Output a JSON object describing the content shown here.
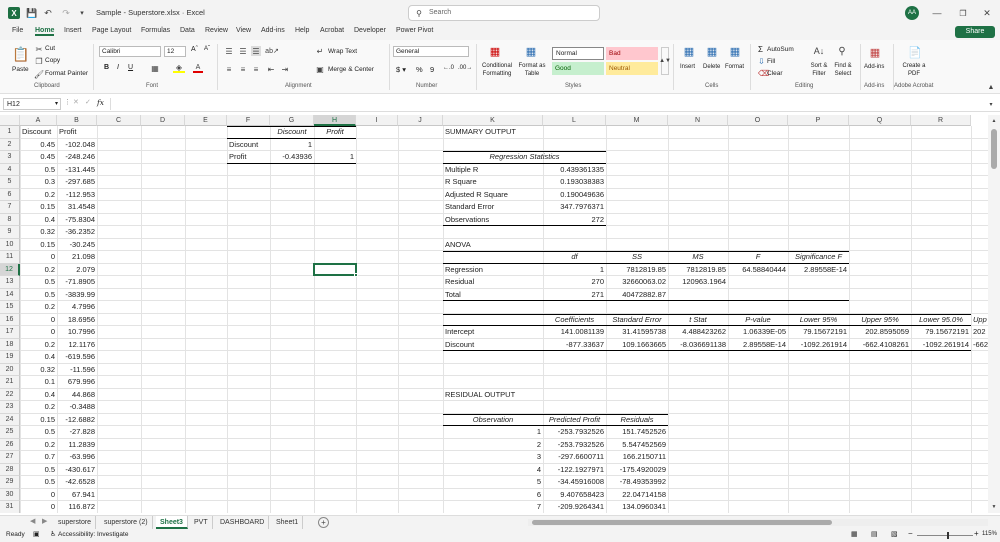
{
  "window": {
    "title": "Sample - Superstore.xlsx  ·  Excel",
    "search_placeholder": "Search",
    "avatar": "AA",
    "share": "Share"
  },
  "menu": [
    "File",
    "Home",
    "Insert",
    "Page Layout",
    "Formulas",
    "Data",
    "Review",
    "View",
    "Add-ins",
    "Help",
    "Acrobat",
    "Developer",
    "Power Pivot"
  ],
  "ribbon": {
    "paste": "Paste",
    "cut": "Cut",
    "copy": "Copy",
    "format_painter": "Format Painter",
    "clipboard": "Clipboard",
    "font_name": "Calibri",
    "font_size": "12",
    "font": "Font",
    "wrap_text": "Wrap Text",
    "merge_center": "Merge & Center",
    "alignment": "Alignment",
    "number_format": "General",
    "number": "Number",
    "cond_format": "Conditional Formatting",
    "format_table": "Format as Table",
    "style_normal": "Normal",
    "style_bad": "Bad",
    "style_good": "Good",
    "style_neutral": "Neutral",
    "styles": "Styles",
    "insert": "Insert",
    "delete": "Delete",
    "format": "Format",
    "cells": "Cells",
    "autosum": "AutoSum",
    "fill": "Fill",
    "clear": "Clear",
    "sort_filter": "Sort & Filter",
    "find_select": "Find & Select",
    "editing": "Editing",
    "addins": "Add-ins",
    "addins_group": "Add-ins",
    "create_pdf": "Create a PDF",
    "adobe": "Adobe Acrobat"
  },
  "formula_bar": {
    "name_box": "H12",
    "fx": "fx",
    "value": ""
  },
  "columns": [
    "A",
    "B",
    "C",
    "D",
    "E",
    "F",
    "G",
    "H",
    "I",
    "J",
    "K",
    "L",
    "M",
    "N",
    "O",
    "P",
    "Q",
    "R"
  ],
  "rows": [
    "1",
    "2",
    "3",
    "4",
    "5",
    "6",
    "7",
    "8",
    "9",
    "10",
    "11",
    "12",
    "13",
    "14",
    "15",
    "16",
    "17",
    "18",
    "19",
    "20",
    "21",
    "22",
    "23",
    "24",
    "25",
    "26",
    "27",
    "28",
    "29",
    "30",
    "31"
  ],
  "colA": [
    "Discount",
    "0.45",
    "0.45",
    "0.5",
    "0.3",
    "0.2",
    "0.15",
    "0.4",
    "0.32",
    "0.15",
    "0",
    "0.2",
    "0.5",
    "0.5",
    "0.2",
    "0",
    "0",
    "0.2",
    "0.4",
    "0.32",
    "0.1",
    "0.4",
    "0.2",
    "0.15",
    "0.5",
    "0.2",
    "0.7",
    "0.5",
    "0.5",
    "0",
    "0"
  ],
  "colB": [
    "Profit",
    "-102.048",
    "-248.246",
    "-131.445",
    "-297.685",
    "-112.953",
    "31.4548",
    "-75.8304",
    "-36.2352",
    "-30.245",
    "21.098",
    "2.079",
    "-71.8905",
    "-3839.99",
    "4.7996",
    "18.6956",
    "10.7996",
    "12.1176",
    "-619.596",
    "-11.596",
    "679.996",
    "44.868",
    "-0.3488",
    "-12.6882",
    "-27.828",
    "11.2839",
    "-63.996",
    "-430.617",
    "-42.6528",
    "67.941",
    "116.872"
  ],
  "corr": {
    "h1": "Discount",
    "h2": "Profit",
    "r1": "Discount",
    "r1v1": "1",
    "r2": "Profit",
    "r2v1": "-0.43936",
    "r2v2": "1"
  },
  "summary": {
    "title": "SUMMARY OUTPUT",
    "regstats": "Regression Statistics",
    "stats": [
      [
        "Multiple R",
        "0.439361335"
      ],
      [
        "R Square",
        "0.193038383"
      ],
      [
        "Adjusted R Square",
        "0.190049636"
      ],
      [
        "Standard Error",
        "347.7976371"
      ],
      [
        "Observations",
        "272"
      ]
    ],
    "anova": "ANOVA",
    "anova_head": [
      "df",
      "SS",
      "MS",
      "F",
      "Significance F"
    ],
    "anova_rows": [
      [
        "Regression",
        "1",
        "7812819.85",
        "7812819.85",
        "64.58840444",
        "2.89558E-14"
      ],
      [
        "Residual",
        "270",
        "32660063.02",
        "120963.1964",
        "",
        ""
      ],
      [
        "Total",
        "271",
        "40472882.87",
        "",
        "",
        ""
      ]
    ],
    "coef_head": [
      "Coefficients",
      "Standard Error",
      "t Stat",
      "P-value",
      "Lower 95%",
      "Upper 95%",
      "Lower 95.0%",
      "Upp"
    ],
    "coef_rows": [
      [
        "Intercept",
        "141.0081139",
        "31.41595738",
        "4.488423262",
        "1.06339E-05",
        "79.15672191",
        "202.8595059",
        "79.15672191",
        "202"
      ],
      [
        "Discount",
        "-877.33637",
        "109.1663665",
        "-8.036691138",
        "2.89558E-14",
        "-1092.261914",
        "-662.4108261",
        "-1092.261914",
        "-662"
      ]
    ],
    "residual_title": "RESIDUAL OUTPUT",
    "res_head": [
      "Observation",
      "Predicted Profit",
      "Residuals"
    ],
    "res_rows": [
      [
        "1",
        "-253.7932526",
        "151.7452526"
      ],
      [
        "2",
        "-253.7932526",
        "5.547452569"
      ],
      [
        "3",
        "-297.6600711",
        "166.2150711"
      ],
      [
        "4",
        "-122.1927971",
        "-175.4920029"
      ],
      [
        "5",
        "-34.45916008",
        "-78.49353992"
      ],
      [
        "6",
        "9.407658423",
        "22.04714158"
      ],
      [
        "7",
        "-209.9264341",
        "134.0960341"
      ]
    ]
  },
  "sheets": [
    "superstore",
    "superstore (2)",
    "Sheet3",
    "PVT",
    "DASHBOARD",
    "Sheet1"
  ],
  "status": {
    "ready": "Ready",
    "accessibility": "Accessibility: Investigate",
    "zoom": "115%"
  }
}
